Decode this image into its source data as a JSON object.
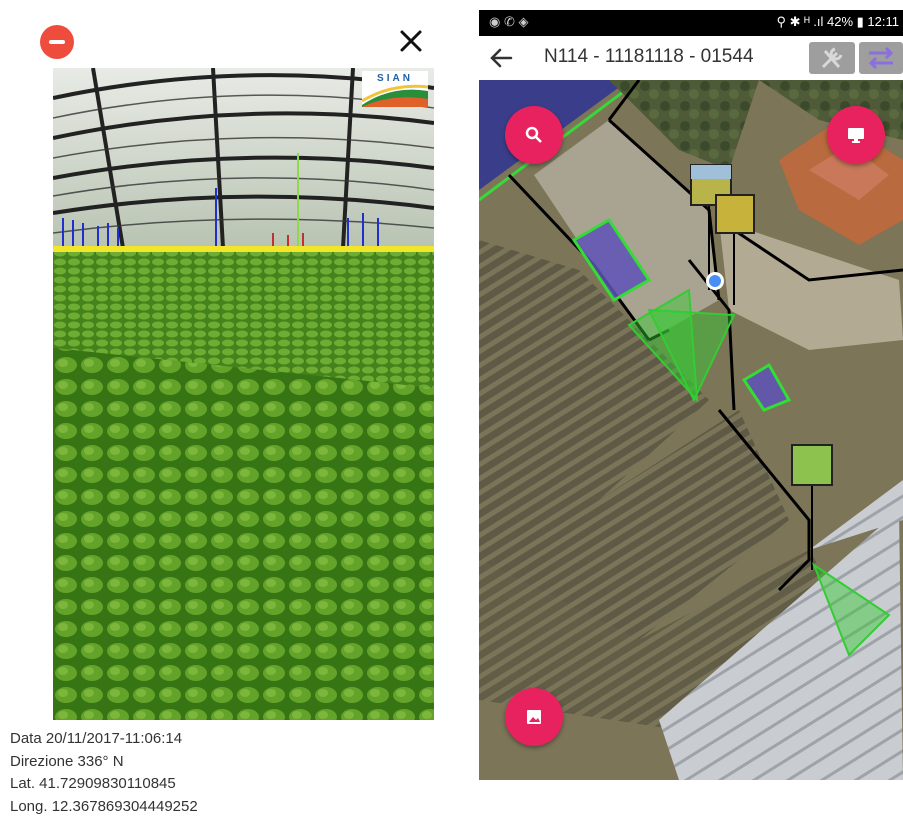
{
  "left_panel": {
    "logo_text": "SIAN",
    "metadata": {
      "date": "Data 20/11/2017-11:06:14",
      "direction": "Direzione 336° N",
      "lat": "Lat. 41.72909830110845",
      "long": "Long. 12.367869304449252"
    },
    "icons": {
      "remove": "remove-circle-icon",
      "close": "close-icon"
    }
  },
  "right_panel": {
    "status_bar": {
      "left_icons": "◉ ✆ ◈",
      "right_text": "⚲ ✱ ᴴ .ıl 42% ▮ 12:11"
    },
    "app_bar": {
      "title": "N114 - 11181118 - 01544",
      "icons": {
        "back": "back-arrow-icon",
        "tools": "tools-icon",
        "swap": "swap-icon"
      }
    },
    "map": {
      "fab_icons": {
        "search": "search-icon",
        "display": "monitor-icon",
        "gallery": "image-icon"
      }
    },
    "colors": {
      "fab": "#e8225e",
      "polygon": "#33cc33",
      "boundary": "#000000"
    }
  }
}
